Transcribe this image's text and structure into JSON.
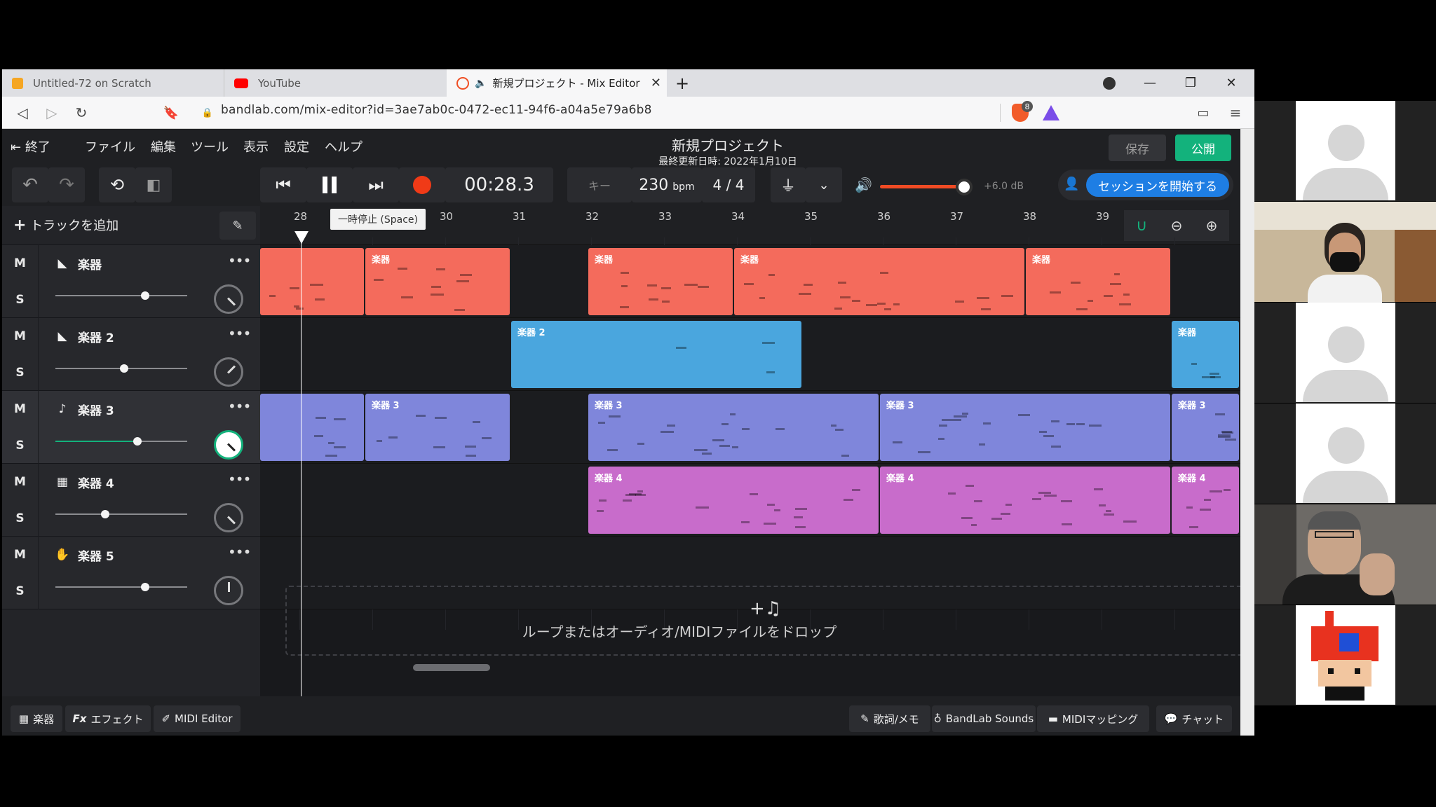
{
  "tabs": [
    {
      "title": "Untitled-72 on Scratch",
      "active": false
    },
    {
      "title": "YouTube",
      "active": false
    },
    {
      "title": "新規プロジェクト - Mix Editor",
      "active": true
    }
  ],
  "address_bar": {
    "url": "bandlab.com/mix-editor?id=3ae7ab0c-0472-ec11-94f6-a04a5e79a6b8",
    "brave_badge": "8"
  },
  "menu": {
    "exit": "終了",
    "items": [
      "ファイル",
      "編集",
      "ツール",
      "表示",
      "設定",
      "ヘルプ"
    ],
    "project_title": "新規プロジェクト",
    "last_updated": "最終更新日時: 2022年1月10日",
    "save": "保存",
    "publish": "公開"
  },
  "transport": {
    "time": "00:28.3",
    "key_label": "キー",
    "tempo": "230",
    "tempo_unit": "bpm",
    "time_signature": "4 / 4",
    "volume_db": "+6.0 dB",
    "volume_level_pct": 88,
    "session_button": "セッションを開始する",
    "tooltip": "一時停止 (Space)"
  },
  "add_track": "トラックを追加",
  "ruler": [
    "28",
    "",
    "30",
    "31",
    "32",
    "33",
    "34",
    "35",
    "36",
    "37",
    "38",
    "39"
  ],
  "tracks": [
    {
      "name": "楽器",
      "icon": "piano-icon",
      "mute": "M",
      "solo": "S",
      "volume_pct": 68,
      "pan_angle": 135,
      "color": "#f46b5c"
    },
    {
      "name": "楽器 2",
      "icon": "piano-icon",
      "mute": "M",
      "solo": "S",
      "volume_pct": 52,
      "pan_angle": 45,
      "color": "#4aa6de"
    },
    {
      "name": "楽器 3",
      "icon": "guitar-icon",
      "mute": "M",
      "solo": "S",
      "volume_pct": 62,
      "pan_angle": 135,
      "color": "#7f86db"
    },
    {
      "name": "楽器 4",
      "icon": "keyboard-icon",
      "mute": "M",
      "solo": "S",
      "volume_pct": 38,
      "pan_angle": 135,
      "color": "#c86ccb"
    },
    {
      "name": "楽器 5",
      "icon": "hand-icon",
      "mute": "M",
      "solo": "S",
      "volume_pct": 68,
      "pan_angle": 0,
      "color": "#999999"
    }
  ],
  "clips": {
    "track1": [
      "楽器",
      "楽器",
      "楽器",
      "楽器"
    ],
    "track2": [
      "楽器 2",
      "楽器"
    ],
    "track3": [
      "楽器 3",
      "楽器 3",
      "楽器 3",
      "楽器 3"
    ],
    "track4": [
      "楽器 4",
      "楽器 4",
      "楽器 4"
    ]
  },
  "dropzone_text": "ループまたはオーディオ/MIDIファイルをドロップ",
  "bottom_left": [
    "楽器",
    "エフェクト",
    "MIDI Editor"
  ],
  "bottom_fx_prefix": "Fx",
  "bottom_right": [
    "歌詞/メモ",
    "BandLab Sounds",
    "MIDIマッピング",
    "チャット"
  ]
}
